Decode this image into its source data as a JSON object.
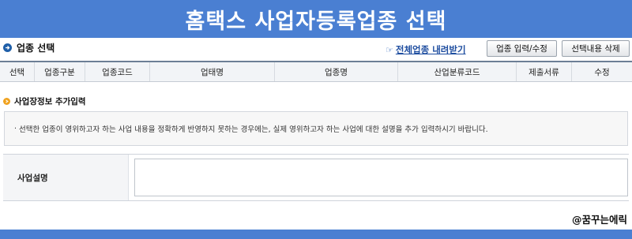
{
  "banner": {
    "title": "홈택스 사업자등록업종 선택"
  },
  "section": {
    "title": "업종 선택",
    "icon": "arrow-circle-icon",
    "download_link": "전체업종 내려받기",
    "download_icon": "pointing-hand-icon",
    "btn_input": "업종 입력/수정",
    "btn_delete": "선택내용 삭제"
  },
  "grid": {
    "columns": [
      "선택",
      "업종구분",
      "업종코드",
      "업태명",
      "업종명",
      "산업분류코드",
      "제출서류",
      "수정"
    ]
  },
  "additional": {
    "title": "사업장정보 추가입력",
    "icon": "orange-bullet-icon",
    "notice": "선택한 업종이 영위하고자 하는 사업 내용을 정확하게 반영하지 못하는 경우에는, 실제 영위하고자 하는 사업에 대한 설명을 추가 입력하시기 바랍니다.",
    "desc_label": "사업설명",
    "desc_value": ""
  },
  "watermark": "@꿈꾸는에릭",
  "colors": {
    "banner": "#4a7fd2",
    "header_border": "#6c7f96",
    "accent_orange": "#f0a21f",
    "link_blue": "#1f4ea0"
  }
}
